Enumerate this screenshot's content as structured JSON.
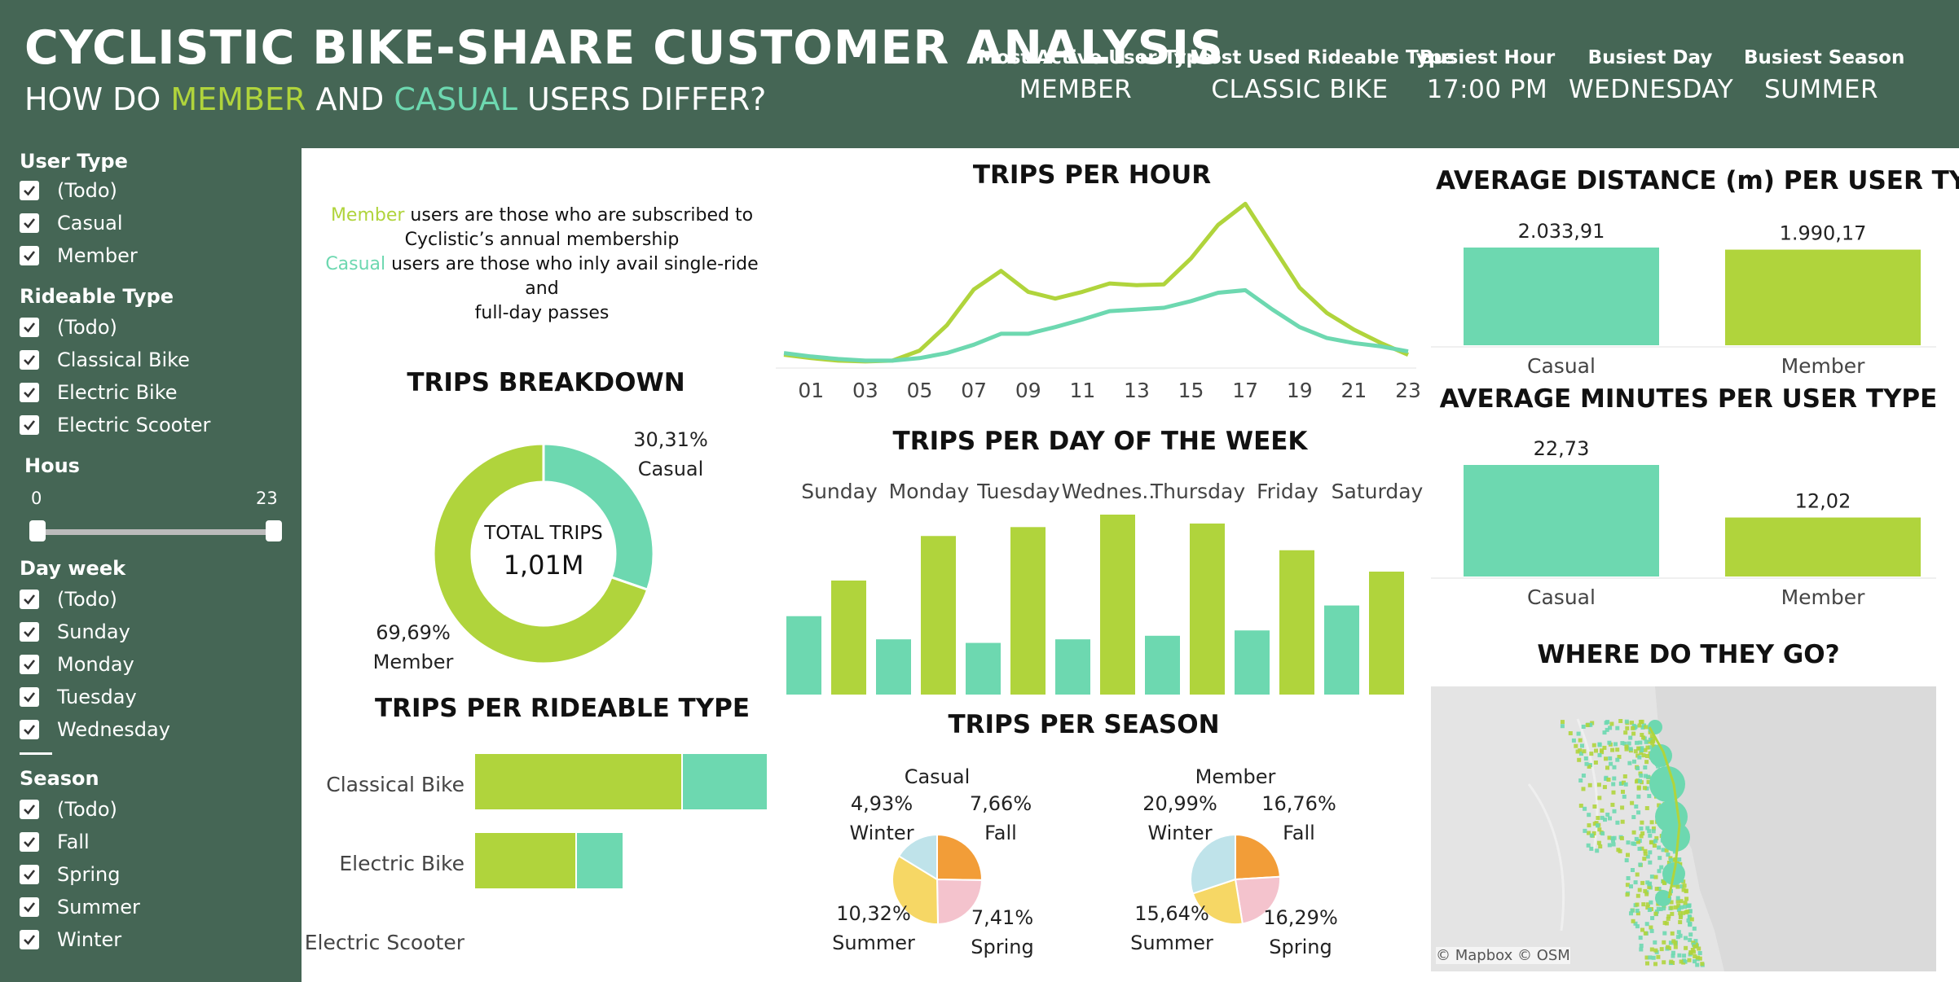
{
  "colors": {
    "header_bg": "#456655",
    "member": "#b0d43c",
    "casual": "#6dd8b0",
    "winter": "#bfe3ea",
    "fall": "#f29d38",
    "spring": "#f4c3cd",
    "summer": "#f6d765"
  },
  "header": {
    "title": "CYCLISTIC BIKE-SHARE CUSTOMER ANALYSIS",
    "subtitle_pre": "HOW DO ",
    "subtitle_member": "MEMBER",
    "subtitle_mid": " AND ",
    "subtitle_casual": "CASUAL",
    "subtitle_post": " USERS DIFFER?",
    "kpis": [
      {
        "label": "Most Active User Type",
        "value": "MEMBER"
      },
      {
        "label": "Most Used Rideable Type",
        "value": "CLASSIC BIKE"
      },
      {
        "label": "Busiest Hour",
        "value": "17:00 PM"
      },
      {
        "label": "Busiest Day",
        "value": "WEDNESDAY"
      },
      {
        "label": "Busiest Season",
        "value": "SUMMER"
      }
    ]
  },
  "filters": {
    "user_type": {
      "title": "User Type",
      "items": [
        "(Todo)",
        "Casual",
        "Member"
      ]
    },
    "rideable_type": {
      "title": "Rideable Type",
      "items": [
        "(Todo)",
        "Classical Bike",
        "Electric Bike",
        "Electric Scooter"
      ]
    },
    "hours": {
      "title": "Hous",
      "min": "0",
      "max": "23"
    },
    "day_week": {
      "title": "Day week",
      "items": [
        "(Todo)",
        "Sunday",
        "Monday",
        "Tuesday",
        "Wednesday"
      ]
    },
    "season": {
      "title": "Season",
      "items": [
        "(Todo)",
        "Fall",
        "Spring",
        "Summer",
        "Winter"
      ]
    }
  },
  "description": {
    "member_word": "Member",
    "member_rest_1": " users are those who are subscribed to",
    "member_rest_2": "Cyclistic’s annual membership",
    "casual_word": "Casual",
    "casual_rest_1": " users are those who inly avail single-ride and",
    "casual_rest_2": "full-day passes"
  },
  "titles": {
    "trips_per_hour": "TRIPS PER HOUR",
    "trips_breakdown": "TRIPS BREAKDOWN",
    "trips_per_day": "TRIPS PER DAY OF THE WEEK",
    "trips_per_rideable": "TRIPS PER RIDEABLE TYPE",
    "trips_per_season": "TRIPS PER SEASON",
    "avg_distance": "AVERAGE DISTANCE (m) PER USER TYPE",
    "avg_minutes": "AVERAGE MINUTES PER USER TYPE",
    "where": "WHERE DO THEY GO?"
  },
  "map": {
    "attribution": "© Mapbox  © OSM"
  },
  "chart_data": [
    {
      "id": "hour",
      "type": "line",
      "title": "TRIPS PER HOUR",
      "x": [
        0,
        1,
        2,
        3,
        4,
        5,
        6,
        7,
        8,
        9,
        10,
        11,
        12,
        13,
        14,
        15,
        16,
        17,
        18,
        19,
        20,
        21,
        22,
        23
      ],
      "tick_labels": [
        "01",
        "03",
        "05",
        "07",
        "09",
        "11",
        "13",
        "15",
        "17",
        "19",
        "21",
        "23"
      ],
      "series": [
        {
          "name": "Member",
          "values": [
            10,
            6,
            3,
            2,
            3,
            15,
            45,
            88,
            110,
            85,
            77,
            85,
            95,
            93,
            94,
            125,
            165,
            190,
            140,
            90,
            60,
            40,
            24,
            10
          ]
        },
        {
          "name": "Casual",
          "values": [
            12,
            8,
            5,
            3,
            3,
            6,
            12,
            22,
            35,
            35,
            43,
            52,
            62,
            64,
            66,
            74,
            84,
            87,
            64,
            43,
            30,
            24,
            20,
            14
          ]
        }
      ]
    },
    {
      "id": "breakdown",
      "type": "pie",
      "title": "TRIPS BREAKDOWN",
      "center_label": "TOTAL TRIPS",
      "center_value": "1,01M",
      "slices": [
        {
          "name": "Casual",
          "value": 30.31,
          "label": "30,31%"
        },
        {
          "name": "Member",
          "value": 69.69,
          "label": "69,69%"
        }
      ]
    },
    {
      "id": "day",
      "type": "bar",
      "title": "TRIPS PER DAY OF THE WEEK",
      "categories": [
        "Sunday",
        "Monday",
        "Tuesday",
        "Wednes..",
        "Thursday",
        "Friday",
        "Saturday"
      ],
      "series": [
        {
          "name": "Casual",
          "values": [
            44,
            31,
            29,
            31,
            33,
            36,
            50
          ]
        },
        {
          "name": "Member",
          "values": [
            64,
            89,
            94,
            101,
            96,
            81,
            69
          ]
        }
      ]
    },
    {
      "id": "rideable",
      "type": "bar",
      "title": "TRIPS PER RIDEABLE TYPE",
      "categories": [
        "Classical Bike",
        "Electric Bike",
        "Electric Scooter"
      ],
      "series": [
        {
          "name": "Member",
          "values": [
            255,
            125,
            0
          ]
        },
        {
          "name": "Casual",
          "values": [
            105,
            58,
            0
          ]
        }
      ]
    },
    {
      "id": "season_casual",
      "type": "pie",
      "title": "Casual",
      "slices": [
        {
          "name": "Fall",
          "value": 7.66,
          "pct": "7,66%",
          "label": "Fall"
        },
        {
          "name": "Spring",
          "value": 7.41,
          "pct": "7,41%",
          "label": "Spring"
        },
        {
          "name": "Summer",
          "value": 10.32,
          "pct": "10,32%",
          "label": "Summer"
        },
        {
          "name": "Winter",
          "value": 4.93,
          "pct": "4,93%",
          "label": "Winter"
        }
      ]
    },
    {
      "id": "season_member",
      "type": "pie",
      "title": "Member",
      "slices": [
        {
          "name": "Fall",
          "value": 16.76,
          "pct": "16,76%",
          "label": "Fall"
        },
        {
          "name": "Spring",
          "value": 16.29,
          "pct": "16,29%",
          "label": "Spring"
        },
        {
          "name": "Summer",
          "value": 15.64,
          "pct": "15,64%",
          "label": "Summer"
        },
        {
          "name": "Winter",
          "value": 20.99,
          "pct": "20,99%",
          "label": "Winter"
        }
      ]
    },
    {
      "id": "distance",
      "type": "bar",
      "title": "AVERAGE DISTANCE (m) PER USER TYPE",
      "categories": [
        "Casual",
        "Member"
      ],
      "values": [
        2033.91,
        1990.17
      ],
      "labels": [
        "2.033,91",
        "1.990,17"
      ]
    },
    {
      "id": "minutes",
      "type": "bar",
      "title": "AVERAGE MINUTES PER USER TYPE",
      "categories": [
        "Casual",
        "Member"
      ],
      "values": [
        22.73,
        12.02
      ],
      "labels": [
        "22,73",
        "12,02"
      ]
    }
  ]
}
